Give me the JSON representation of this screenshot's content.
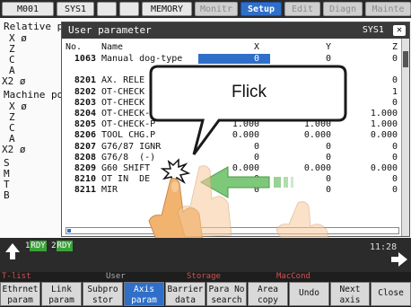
{
  "tabs": {
    "m001": "M001",
    "sys1": "SYS1",
    "blank1": "",
    "blank2": "",
    "memory": "MEMORY",
    "monitr": "Monitr",
    "setup": "Setup",
    "edit": "Edit",
    "diagn": "Diagn",
    "mainte": "Mainte"
  },
  "background": {
    "relative": "Relative p",
    "rel_axes": [
      "X ø",
      "Z",
      "C",
      "A",
      "X2 ø"
    ],
    "machine": "Machine po",
    "mac_axes": [
      "X ø",
      "Z",
      "C",
      "A",
      "X2 ø"
    ],
    "side_letters": [
      "S",
      "M",
      "T",
      "B"
    ]
  },
  "window": {
    "title": "User parameter",
    "system": "SYS1",
    "close": "✕",
    "headers": {
      "no": "No.",
      "name": "Name",
      "x": "X",
      "y": "Y",
      "z": "Z"
    },
    "rows": [
      {
        "no": "1063",
        "name": "Manual dog-type",
        "x": "0",
        "y": "0",
        "z": "0"
      },
      {
        "no": "",
        "name": "",
        "x": "",
        "y": "",
        "z": ""
      },
      {
        "no": "8201",
        "name": "AX. RELE",
        "x": "",
        "y": "",
        "z": "0"
      },
      {
        "no": "8202",
        "name": "OT-CHECK",
        "x": "",
        "y": "",
        "z": "1"
      },
      {
        "no": "8203",
        "name": "OT-CHECK",
        "x": "",
        "y": "",
        "z": "0"
      },
      {
        "no": "8204",
        "name": "OT-CHECK-N",
        "x": "1.000",
        "y": "1.000",
        "z": "1.000"
      },
      {
        "no": "8205",
        "name": "OT-CHECK-P",
        "x": "1.000",
        "y": "1.000",
        "z": "1.000"
      },
      {
        "no": "8206",
        "name": "TOOL CHG.P",
        "x": "0.000",
        "y": "0.000",
        "z": "0.000"
      },
      {
        "no": "8207",
        "name": "G76/87 IGNR",
        "x": "0",
        "y": "0",
        "z": "0"
      },
      {
        "no": "8208",
        "name": "G76/8  (-)",
        "x": "0",
        "y": "0",
        "z": "0"
      },
      {
        "no": "8209",
        "name": "G60 SHIFT",
        "x": "0.000",
        "y": "0.000",
        "z": "0.000"
      },
      {
        "no": "8210",
        "name": "OT IN  DE",
        "x": "0",
        "y": "0",
        "z": "0"
      },
      {
        "no": "8211",
        "name": "MIR",
        "x": "0",
        "y": "0",
        "z": "0"
      }
    ]
  },
  "callout": {
    "text": "Flick"
  },
  "status": {
    "rdy1": "1",
    "rdy1_tag": "RDY",
    "rdy2": "2",
    "rdy2_tag": "RDY",
    "time": "11:28"
  },
  "labels": {
    "tlist": "T-list",
    "user": "User",
    "storage": "Storage",
    "maccond": "MacCond"
  },
  "fkeys": [
    {
      "l1": "Ethrnet",
      "l2": "param"
    },
    {
      "l1": "Link",
      "l2": "param"
    },
    {
      "l1": "Subpro",
      "l2": "stor"
    },
    {
      "l1": "Axis",
      "l2": "param"
    },
    {
      "l1": "Barrier",
      "l2": "data"
    },
    {
      "l1": "Para No",
      "l2": "search"
    },
    {
      "l1": "Area",
      "l2": "copy"
    },
    {
      "l1": "Undo",
      "l2": ""
    },
    {
      "l1": "Next",
      "l2": "axis"
    },
    {
      "l1": "Close",
      "l2": ""
    }
  ],
  "colors": {
    "accent": "#2f6fc9",
    "ready": "#3aa23a",
    "hand": "#f2b36f",
    "arrow": "#7ec87a"
  }
}
